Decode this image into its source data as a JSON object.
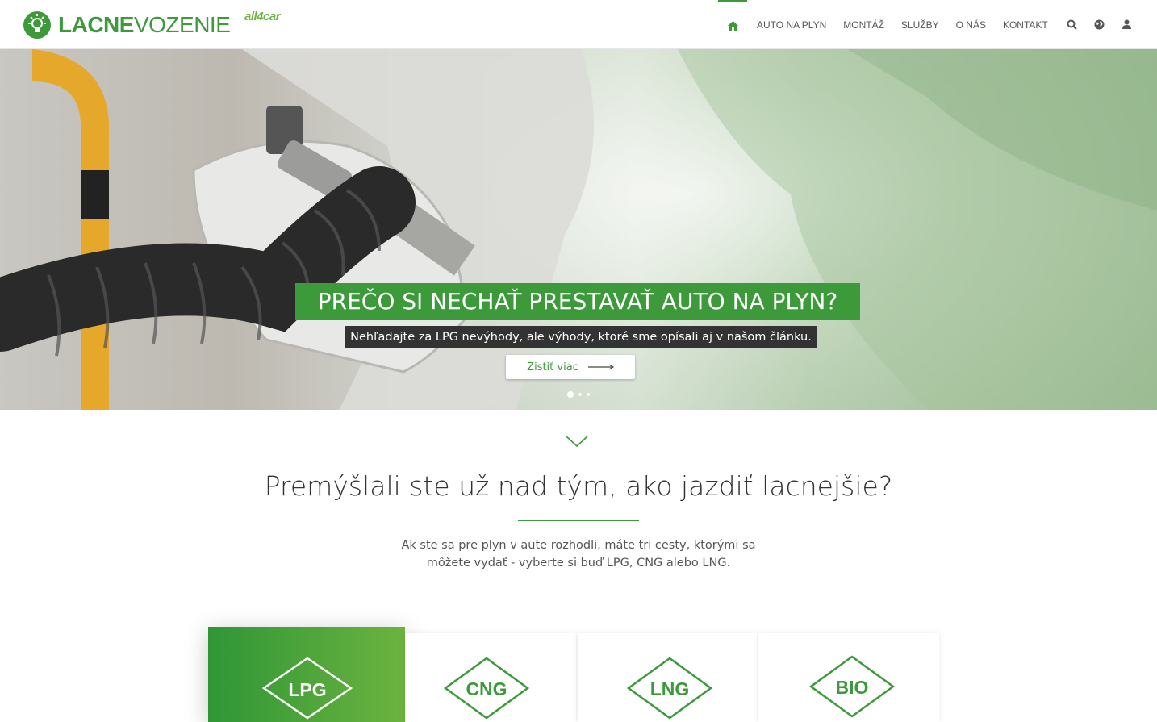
{
  "brand": {
    "logo_bold": "LACNE",
    "logo_light": "VOZENIE",
    "partner": "all4car",
    "accent": "#3d9a3a",
    "accent_light": "#6cb33f"
  },
  "nav": {
    "home_icon": "home-icon",
    "items": [
      {
        "label": "AUTO NA PLYN"
      },
      {
        "label": "MONTÁŽ"
      },
      {
        "label": "SLUŽBY"
      },
      {
        "label": "O NÁS"
      },
      {
        "label": "KONTAKT"
      }
    ],
    "icons": [
      "search-icon",
      "globe-icon",
      "user-icon"
    ]
  },
  "hero": {
    "title": "PREČO SI NECHAŤ PRESTAVAŤ AUTO NA PLYN?",
    "subtitle": "Nehľadajte za LPG nevýhody, ale výhody, ktoré sme opísali aj v našom článku.",
    "button_label": "Zistiť viac",
    "slides_count": 3,
    "active_slide": 1
  },
  "section": {
    "heading": "Premýšlali ste už nad tým, ako jazdiť lacnejšie?",
    "intro_line1": "Ak ste sa pre plyn v aute rozhodli, máte tri cesty, ktorými sa",
    "intro_line2": "môžete vydať - vyberte si buď LPG, CNG alebo LNG."
  },
  "cards": [
    {
      "label": "LPG",
      "active": true
    },
    {
      "label": "CNG",
      "active": false
    },
    {
      "label": "LNG",
      "active": false
    },
    {
      "label": "BIO",
      "active": false
    }
  ]
}
